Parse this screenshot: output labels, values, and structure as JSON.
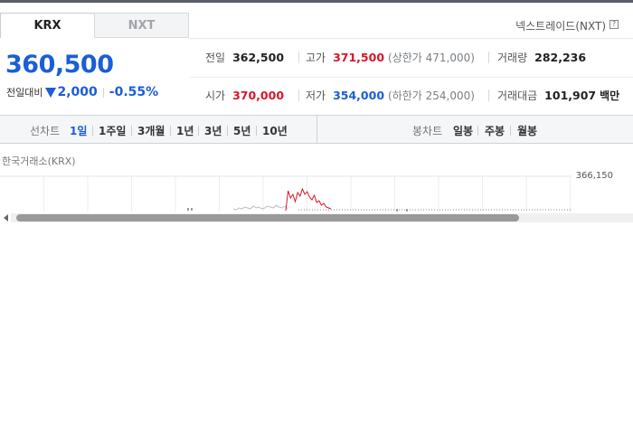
{
  "tabs": {
    "krx": "KRX",
    "nxt": "NXT"
  },
  "nxt_link": "넥스트레이드(NXT)",
  "help_icon": "?",
  "price": {
    "current": "360,500",
    "change_label": "전일대비",
    "change": "2,000",
    "change_pct": "-0.55%",
    "direction": "down"
  },
  "stats": {
    "prev_close": {
      "label": "전일",
      "value": "362,500"
    },
    "high": {
      "label": "고가",
      "value": "371,500",
      "extra": "(상한가 471,000)"
    },
    "volume": {
      "label": "거래량",
      "value": "282,236"
    },
    "open": {
      "label": "시가",
      "value": "370,000"
    },
    "low": {
      "label": "저가",
      "value": "354,000",
      "extra": "(하한가 254,000)"
    },
    "amount": {
      "label": "거래대금",
      "value": "101,907",
      "unit": "백만"
    }
  },
  "toolbar": {
    "line_chart_label": "선차트",
    "periods": [
      "1일",
      "1주일",
      "3개월",
      "1년",
      "3년",
      "5년",
      "10년"
    ],
    "active_period": "1일",
    "candle_label": "봉차트",
    "candles": [
      "일봉",
      "주봉",
      "월봉"
    ]
  },
  "chart_source": "한국거래소(KRX)",
  "chart_y_label": "366,150",
  "colors": {
    "up": "#d9162a",
    "down": "#1a5ed8",
    "accent": "#1a5ed8"
  },
  "chart_data": {
    "type": "line",
    "title": "",
    "xlabel": "",
    "ylabel": "",
    "y_tick_labels": [
      "366,150"
    ],
    "grid": true,
    "series": [
      {
        "values": [
          2,
          1,
          3,
          2,
          4,
          3,
          2,
          5,
          3,
          4,
          2,
          3,
          5,
          4,
          3,
          6,
          4,
          3,
          5,
          2
        ]
      },
      {
        "values": [
          0,
          22,
          14,
          18,
          10,
          20,
          16,
          24,
          18,
          21,
          15,
          12,
          17,
          9,
          11,
          6,
          8,
          4,
          3,
          2
        ]
      }
    ]
  }
}
